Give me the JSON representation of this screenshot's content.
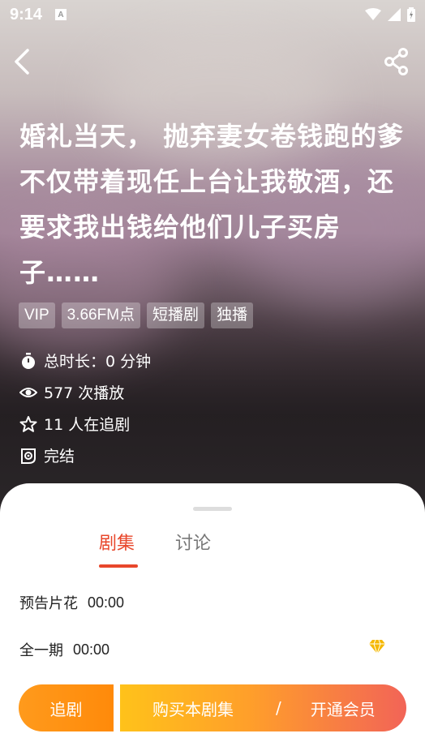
{
  "status_bar": {
    "time": "9:14",
    "notif_letter": "A"
  },
  "drama": {
    "title": "婚礼当天， 抛弃妻女卷钱跑的爹不仅带着现任上台让我敬酒，还要求我出钱给他们儿子买房子……",
    "tags": [
      "VIP",
      "3.66FM点",
      "短播剧",
      "独播"
    ],
    "duration": "总时长：0 分钟",
    "plays": "577 次播放",
    "followers": "11 人在追剧",
    "status": "完结"
  },
  "tabs": {
    "episodes": "剧集",
    "discussion": "讨论"
  },
  "episodes": [
    {
      "name": "预告片花",
      "time": "00:00",
      "vip": false
    },
    {
      "name": "全一期",
      "time": "00:00",
      "vip": true
    }
  ],
  "actions": {
    "follow": "追剧",
    "buy": "购买本剧集",
    "separator": "/",
    "member": "开通会员"
  },
  "colors": {
    "accent": "#e8472b",
    "orange": "#ff8a0a",
    "gold": "#ffc21a"
  }
}
